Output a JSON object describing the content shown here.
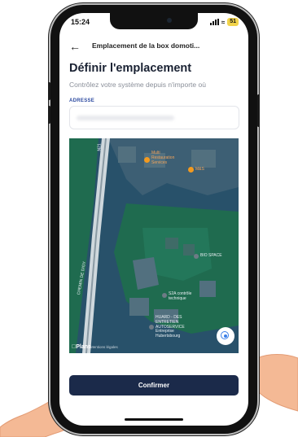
{
  "status": {
    "time": "15:24",
    "battery": "51"
  },
  "nav": {
    "title": "Emplacement de la box domoti..."
  },
  "page": {
    "heading": "Définir l'emplacement",
    "subtitle": "Contrôlez votre système depuis n'importe où",
    "address_label": "ADRESSE"
  },
  "map": {
    "labels": {
      "road": "CHEMIN DE DIGY",
      "road_top": "N21",
      "poi_1": "Multi Restauration Services",
      "poi_2": "M&S",
      "poi_3": "BIO SPACE",
      "poi_4": "S2A contrôle technique",
      "poi_5": "HUARD - DES ENTRETIEN AUTOSERVICE Entreprise Hubertsbourg"
    },
    "attribution": "Plans",
    "legal": "Mentions légales"
  },
  "confirm_label": "Confirmer",
  "colors": {
    "accent": "#1b2a4a",
    "map_water": "#28516a",
    "map_green": "#1f6b4f",
    "label_blue": "#2c4aa0"
  }
}
